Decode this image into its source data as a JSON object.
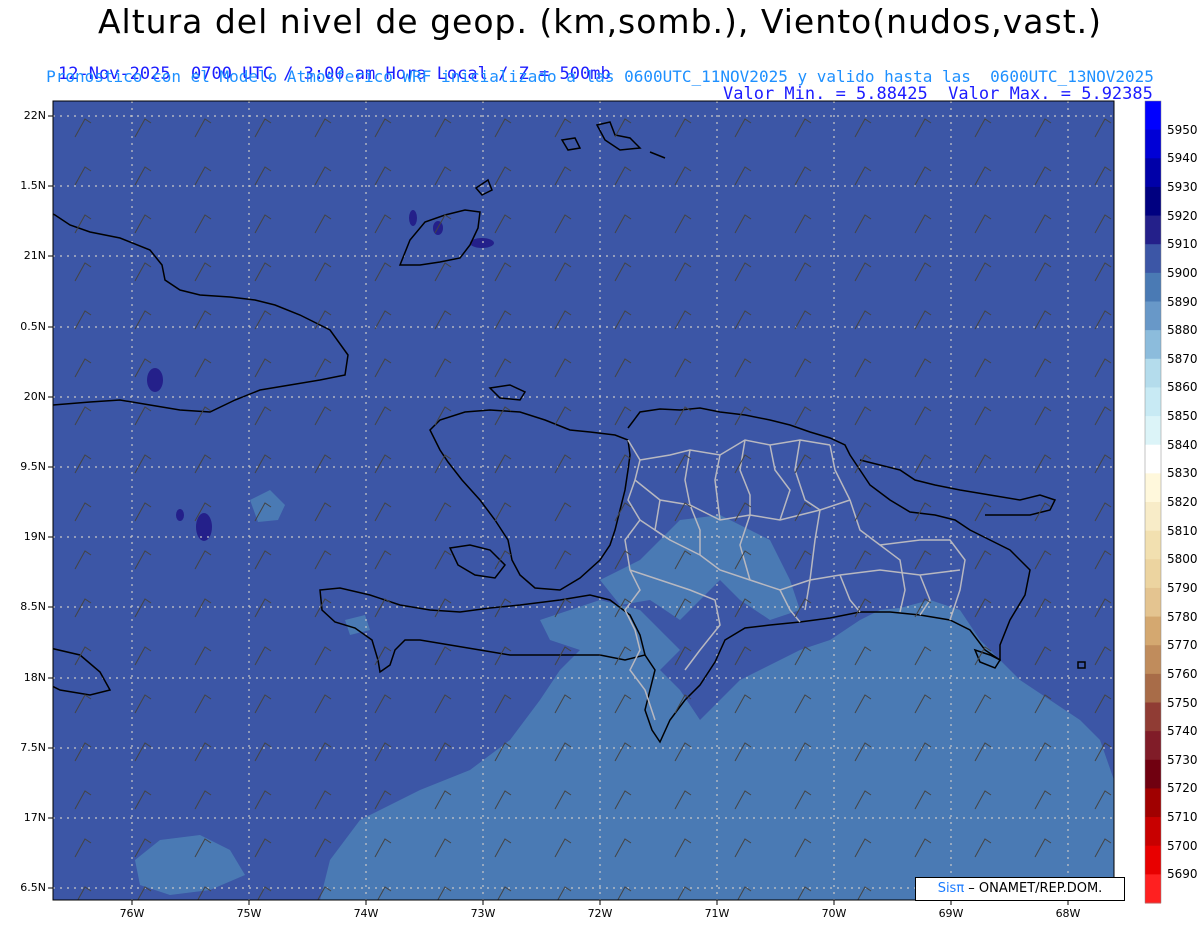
{
  "header": {
    "title": "Altura del nivel de geop. (km,somb.), Viento(nudos,vast.)",
    "date_line": "12-Nov-2025  0700 UTC / 3:00 am Hora Local / Z = 500mb",
    "minmax_line": "Valor Min. = 5.88425  Valor Max. = 5.92385",
    "model_line": "Pronostico con el Modelo Atmosferico WRF inicializado a las 0600UTC_11NOV2025 y valido hasta las  0600UTC_13NOV2025"
  },
  "axes": {
    "lat_labels": [
      "22N",
      "1.5N",
      "21N",
      "0.5N",
      "20N",
      "9.5N",
      "19N",
      "8.5N",
      "18N",
      "7.5N",
      "17N",
      "6.5N"
    ],
    "lon_labels": [
      "76W",
      "75W",
      "74W",
      "73W",
      "72W",
      "71W",
      "70W",
      "69W",
      "68W"
    ]
  },
  "colorbar": {
    "labels": [
      "5950",
      "5940",
      "5930",
      "5920",
      "5910",
      "5900",
      "5890",
      "5880",
      "5870",
      "5860",
      "5850",
      "5840",
      "5830",
      "5820",
      "5810",
      "5800",
      "5790",
      "5780",
      "5770",
      "5760",
      "5750",
      "5740",
      "5730",
      "5720",
      "5710",
      "5700",
      "5690"
    ],
    "colors": [
      "#0000ff",
      "#0000d6",
      "#0000a8",
      "#000080",
      "#24208a",
      "#3c56a6",
      "#4a7ab4",
      "#6898c8",
      "#8cbcdc",
      "#b4dcec",
      "#c8eaf4",
      "#dcf4f8",
      "#ffffff",
      "#fff8dc",
      "#f8ecc8",
      "#f2e0b0",
      "#ecd4a0",
      "#e4c490",
      "#d4a870",
      "#c08c5c",
      "#a86c48",
      "#903c34",
      "#801c28",
      "#700010",
      "#a00000",
      "#c80000",
      "#e80000",
      "#ff2020"
    ]
  },
  "credit": {
    "sis": "Sisπ",
    "rest": " – ONAMET/REP.DOM."
  },
  "colors": {
    "field_dark": "#3c56a6",
    "field_light": "#4a7ab4",
    "field_lighter": "#6898c8",
    "field_max": "#24208a"
  }
}
